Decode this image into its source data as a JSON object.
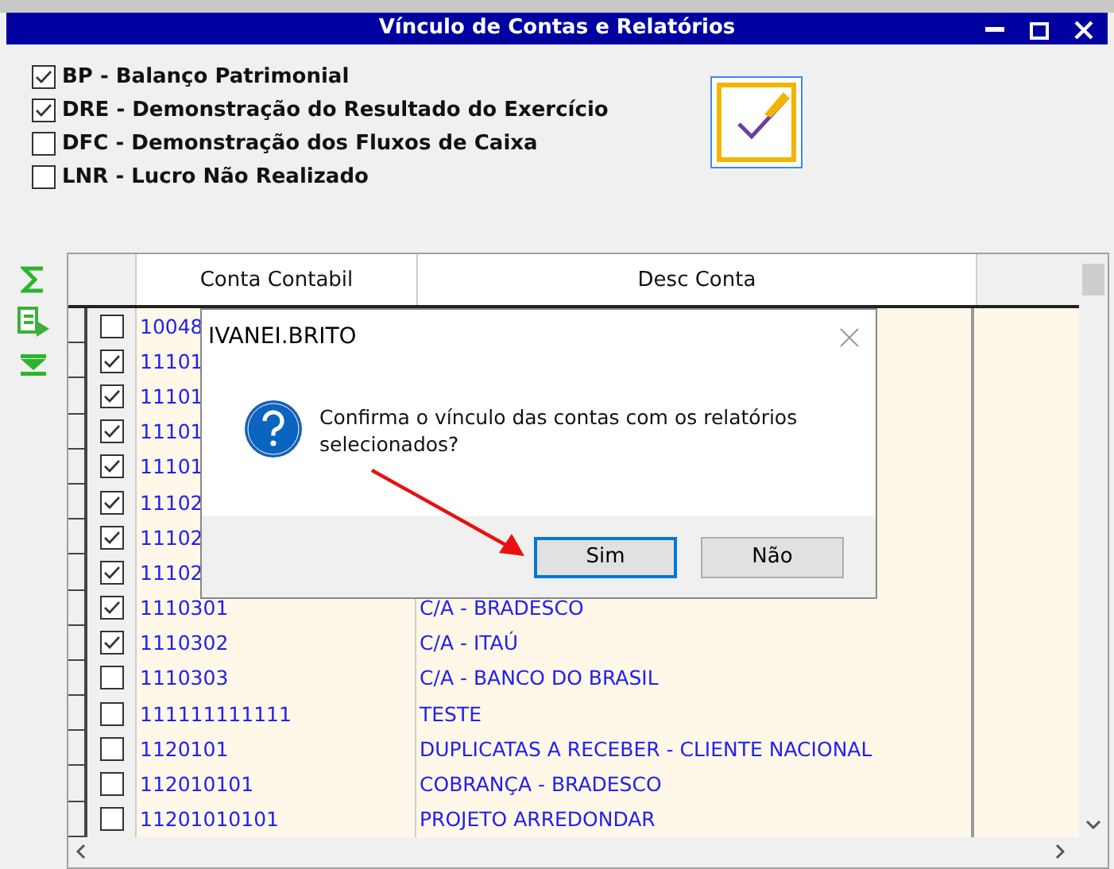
{
  "window": {
    "title": "Vínculo de Contas e Relatórios"
  },
  "reports": [
    {
      "label": "BP - Balanço Patrimonial",
      "checked": true
    },
    {
      "label": "DRE - Demonstração do Resultado do Exercício",
      "checked": true
    },
    {
      "label": "DFC - Demonstração dos Fluxos de Caixa",
      "checked": false
    },
    {
      "label": "LNR - Lucro Não Realizado",
      "checked": false
    }
  ],
  "table": {
    "columns": [
      "Conta Contabil",
      "Desc Conta"
    ],
    "rows": [
      {
        "checked": false,
        "code": "10048"
      },
      {
        "checked": true,
        "code": "11101"
      },
      {
        "checked": true,
        "code": "11101"
      },
      {
        "checked": true,
        "code": "11101"
      },
      {
        "checked": true,
        "code": "11101"
      },
      {
        "checked": true,
        "code": "11102"
      },
      {
        "checked": true,
        "code": "11102"
      },
      {
        "checked": true,
        "code": "11102"
      },
      {
        "checked": true,
        "code": "1110301",
        "desc": "C/A - BRADESCO"
      },
      {
        "checked": true,
        "code": "1110302",
        "desc": "C/A - ITAÚ"
      },
      {
        "checked": false,
        "code": "1110303",
        "desc": "C/A - BANCO DO BRASIL"
      },
      {
        "checked": false,
        "code": "111111111111",
        "desc": "TESTE"
      },
      {
        "checked": false,
        "code": "1120101",
        "desc": "DUPLICATAS A RECEBER - CLIENTE NACIONAL"
      },
      {
        "checked": false,
        "code": "112010101",
        "desc": "COBRANÇA - BRADESCO"
      },
      {
        "checked": false,
        "code": "11201010101",
        "desc": "PROJETO ARREDONDAR"
      }
    ]
  },
  "dialog": {
    "title": "IVANEI.BRITO",
    "message": "Confirma o vínculo das contas com os relatórios selecionados?",
    "buttons": [
      {
        "label": "Sim",
        "selected": true
      },
      {
        "label": "Não",
        "selected": false
      }
    ]
  }
}
